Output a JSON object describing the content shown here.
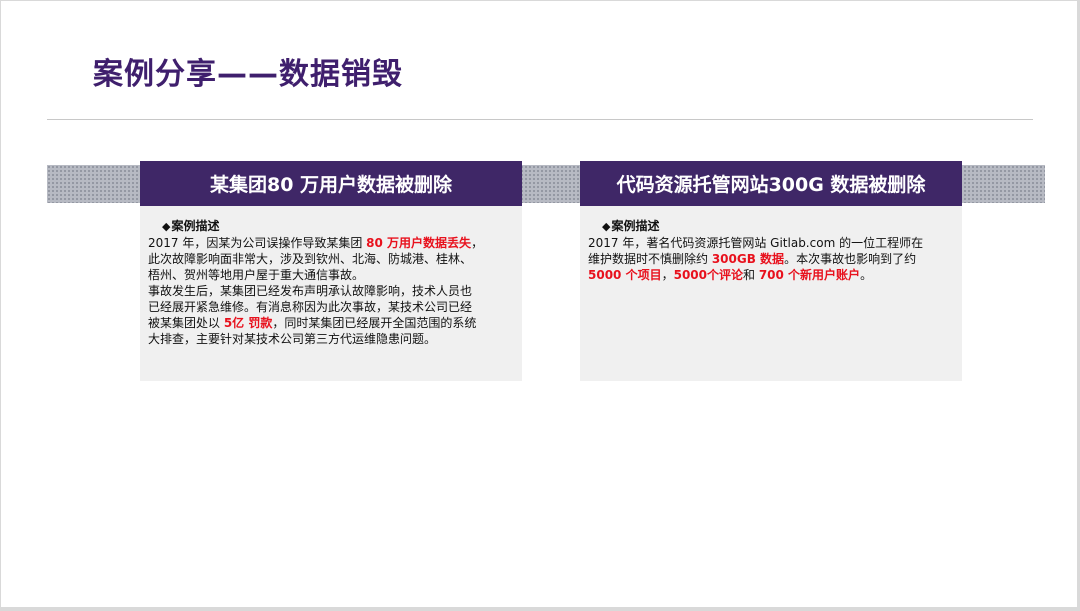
{
  "slide": {
    "title": "案例分享——数据销毁"
  },
  "cards": [
    {
      "header": "某集团80 万用户数据被删除",
      "subheading": "案例描述",
      "lines": [
        [
          "2017 年，因某为公司误操作导致某集团 ",
          "80 万用户数据丢失",
          "，"
        ],
        [
          "此次故障影响面非常大，涉及到钦州、北海、防城港、桂林、"
        ],
        [
          "梧州、贺州等地用户屋于重大通信事故。"
        ],
        [
          "事故发生后，某集团已经发布声明承认故障影响，技术人员也"
        ],
        [
          "已经展开紧急维修。有消息称因为此次事故，某技术公司已经"
        ],
        [
          "被某集团处以 ",
          "5亿 罚款",
          "，同时某集团已经展开全国范围的系统"
        ],
        [
          "大排查，主要针对某技术公司第三方代运维隐患问题。"
        ]
      ]
    },
    {
      "header": "代码资源托管网站300G 数据被删除",
      "subheading": "案例描述",
      "lines": [
        [
          "2017 年，著名代码资源托管网站 Gitlab.com 的一位工程师在"
        ],
        [
          "维护数据时不慎删除约 ",
          "300GB 数据",
          "。本次事故也影响到了约"
        ],
        [
          "",
          "5000 个项目",
          "，",
          "5000个评论",
          "和 ",
          "700 个新用户账户",
          "。"
        ]
      ]
    }
  ],
  "colors": {
    "title": "#3f1f6d",
    "header_bg": "#3f2767",
    "highlight": "#e8111d"
  }
}
